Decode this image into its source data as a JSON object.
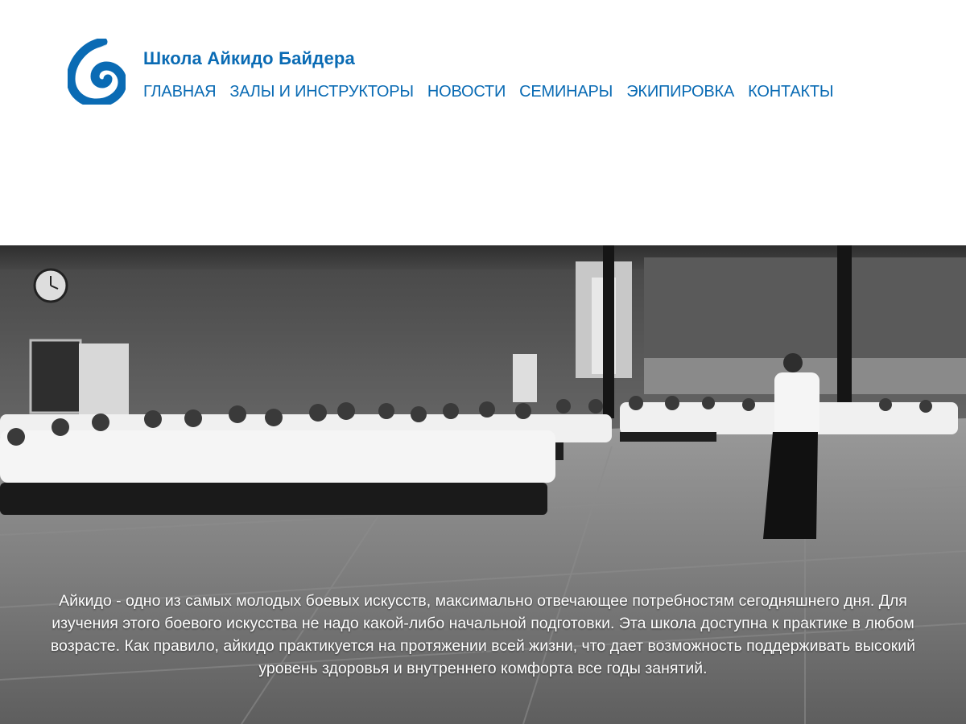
{
  "header": {
    "site_title": "Школа Айкидо Байдера",
    "logo_icon": "ensō-brush-logo-icon",
    "brand_color": "#0a6bb4"
  },
  "nav": {
    "items": [
      {
        "label": "ГЛАВНАЯ"
      },
      {
        "label": "ЗАЛЫ И ИНСТРУКТОРЫ"
      },
      {
        "label": "НОВОСТИ"
      },
      {
        "label": "СЕМИНАРЫ"
      },
      {
        "label": "ЭКИПИРОВКА"
      },
      {
        "label": "КОНТАКТЫ"
      }
    ]
  },
  "hero": {
    "image_subject": "dojo-seated-students-and-instructor-photo",
    "description": "Айкидо - одно из самых молодых боевых искусств, максимально отвечающее потребностям сегодняшнего дня. Для изучения этого боевого искусства не надо какой-либо начальной подготовки. Эта школа доступна к практике в любом возрасте. Как правило, айкидо практикуется на протяжении всей жизни, что дает возможность поддерживать высокий уровень здоровья и внутреннего комфорта все годы занятий."
  }
}
